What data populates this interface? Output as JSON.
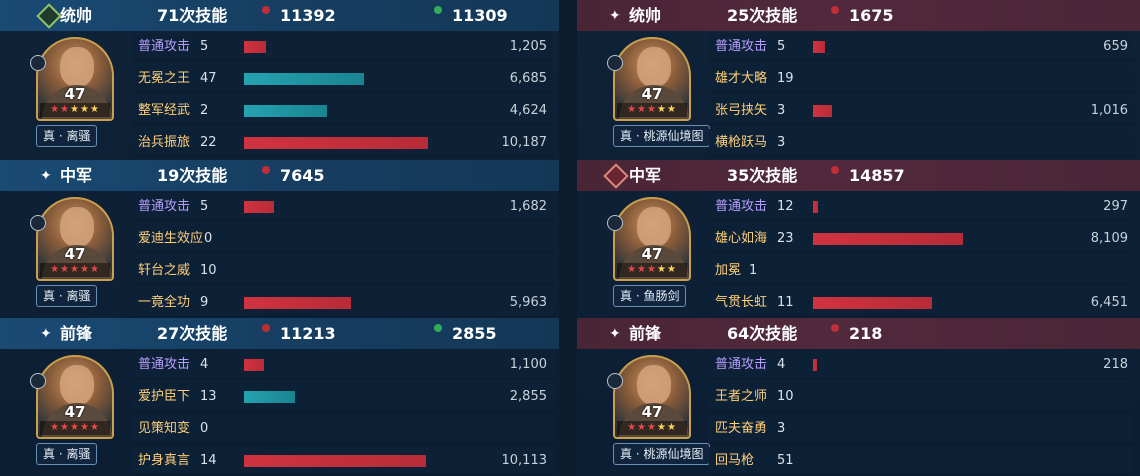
{
  "colors": {
    "accent_red": "#c22e36",
    "accent_green": "#2fae57",
    "bar_red": "#d0333f",
    "bar_teal": "#25a3b0",
    "purple_text": "#b69dff",
    "gold_text": "#ffcf7a"
  },
  "left": {
    "blocks": [
      {
        "role": "统帅",
        "skill_count": "71次技能",
        "stat_red": "11392",
        "stat_green": "11309",
        "level": "47",
        "stars_red": 2,
        "stars_gold": 3,
        "tag": "真 · 离骚",
        "rows": [
          {
            "skill": "普通攻击",
            "count": "5",
            "bar": "red",
            "fill": 0.0804,
            "value": "1,205",
            "purple": true
          },
          {
            "skill": "无冕之王",
            "count": "47",
            "bar": "teal",
            "fill": 0.4461,
            "value": "6,685",
            "purple": false
          },
          {
            "skill": "整军经武",
            "count": "2",
            "bar": "teal",
            "fill": 0.3086,
            "value": "4,624",
            "purple": false
          },
          {
            "skill": "治兵振旅",
            "count": "22",
            "bar": "red",
            "fill": 0.6799,
            "value": "10,187",
            "purple": false
          }
        ]
      },
      {
        "role": "中军",
        "skill_count": "19次技能",
        "stat_red": "7645",
        "stat_green": "",
        "level": "47",
        "stars_red": 5,
        "stars_gold": 0,
        "tag": "真 · 离骚",
        "rows": [
          {
            "skill": "普通攻击",
            "count": "5",
            "bar": "red",
            "fill": 0.1123,
            "value": "1,682",
            "purple": true
          },
          {
            "skill": "爱迪生效应",
            "count": "0",
            "bar": "",
            "fill": 0,
            "value": "",
            "purple": false
          },
          {
            "skill": "轩台之威",
            "count": "10",
            "bar": "",
            "fill": 0,
            "value": "",
            "purple": false
          },
          {
            "skill": "一竟全功",
            "count": "9",
            "bar": "red",
            "fill": 0.398,
            "value": "5,963",
            "purple": false
          }
        ]
      },
      {
        "role": "前锋",
        "skill_count": "27次技能",
        "stat_red": "11213",
        "stat_green": "2855",
        "level": "47",
        "stars_red": 5,
        "stars_gold": 0,
        "tag": "真 · 离骚",
        "rows": [
          {
            "skill": "普通攻击",
            "count": "4",
            "bar": "red",
            "fill": 0.0734,
            "value": "1,100",
            "purple": true
          },
          {
            "skill": "爱护臣下",
            "count": "13",
            "bar": "teal",
            "fill": 0.1905,
            "value": "2,855",
            "purple": false
          },
          {
            "skill": "见策知变",
            "count": "0",
            "bar": "",
            "fill": 0,
            "value": "",
            "purple": false
          },
          {
            "skill": "护身真言",
            "count": "14",
            "bar": "red",
            "fill": 0.675,
            "value": "10,113",
            "purple": false
          }
        ]
      }
    ]
  },
  "right": {
    "blocks": [
      {
        "role": "统帅",
        "skill_count": "25次技能",
        "stat_red": "1675",
        "stat_green": "",
        "level": "47",
        "stars_red": 3,
        "stars_gold": 2,
        "tag": "真 · 桃源仙境图",
        "rows": [
          {
            "skill": "普通攻击",
            "count": "5",
            "bar": "red",
            "fill": 0.0406,
            "value": "659",
            "purple": true
          },
          {
            "skill": "雄才大略",
            "count": "19",
            "bar": "",
            "fill": 0,
            "value": "",
            "purple": false
          },
          {
            "skill": "张弓挟矢",
            "count": "3",
            "bar": "red",
            "fill": 0.0627,
            "value": "1,016",
            "purple": false
          },
          {
            "skill": "横枪跃马",
            "count": "3",
            "bar": "",
            "fill": 0,
            "value": "",
            "purple": false
          }
        ]
      },
      {
        "role": "中军",
        "skill_count": "35次技能",
        "stat_red": "14857",
        "stat_green": "",
        "level": "47",
        "stars_red": 3,
        "stars_gold": 2,
        "tag": "真 · 鱼肠剑",
        "rows": [
          {
            "skill": "普通攻击",
            "count": "12",
            "bar": "red",
            "fill": 0.0183,
            "value": "297",
            "purple": true
          },
          {
            "skill": "雄心如海",
            "count": "23",
            "bar": "red",
            "fill": 0.5003,
            "value": "8,109",
            "purple": false
          },
          {
            "skill": "加冕",
            "count": "1",
            "bar": "",
            "fill": 0,
            "value": "",
            "purple": false
          },
          {
            "skill": "气贯长虹",
            "count": "11",
            "bar": "red",
            "fill": 0.398,
            "value": "6,451",
            "purple": false
          }
        ]
      },
      {
        "role": "前锋",
        "skill_count": "64次技能",
        "stat_red": "218",
        "stat_green": "",
        "level": "47",
        "stars_red": 3,
        "stars_gold": 2,
        "tag": "真 · 桃源仙境图",
        "rows": [
          {
            "skill": "普通攻击",
            "count": "4",
            "bar": "red",
            "fill": 0.0134,
            "value": "218",
            "purple": true
          },
          {
            "skill": "王者之师",
            "count": "10",
            "bar": "",
            "fill": 0,
            "value": "",
            "purple": false
          },
          {
            "skill": "匹夫奋勇",
            "count": "3",
            "bar": "",
            "fill": 0,
            "value": "",
            "purple": false
          },
          {
            "skill": "回马枪",
            "count": "51",
            "bar": "",
            "fill": 0,
            "value": "",
            "purple": false
          }
        ]
      }
    ]
  }
}
